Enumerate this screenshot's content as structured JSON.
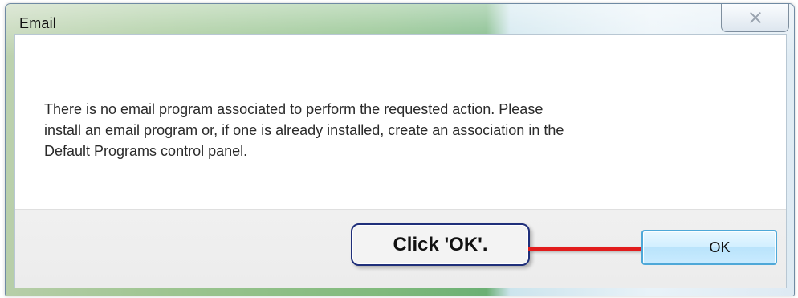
{
  "window": {
    "title": "Email"
  },
  "message": {
    "text": "There is no email program associated to perform the requested action. Please\ninstall an email program or, if one is already installed, create an association in the\nDefault Programs control panel."
  },
  "buttons": {
    "ok_label": "OK"
  },
  "annotation": {
    "callout_text": "Click 'OK'."
  },
  "icons": {
    "close": "close-icon",
    "arrow": "arrow-icon"
  },
  "colors": {
    "title_gradient_green": "#7db879",
    "button_border": "#4ea8d8",
    "callout_border": "#1f2f7a",
    "arrow_red": "#e21b1b"
  }
}
